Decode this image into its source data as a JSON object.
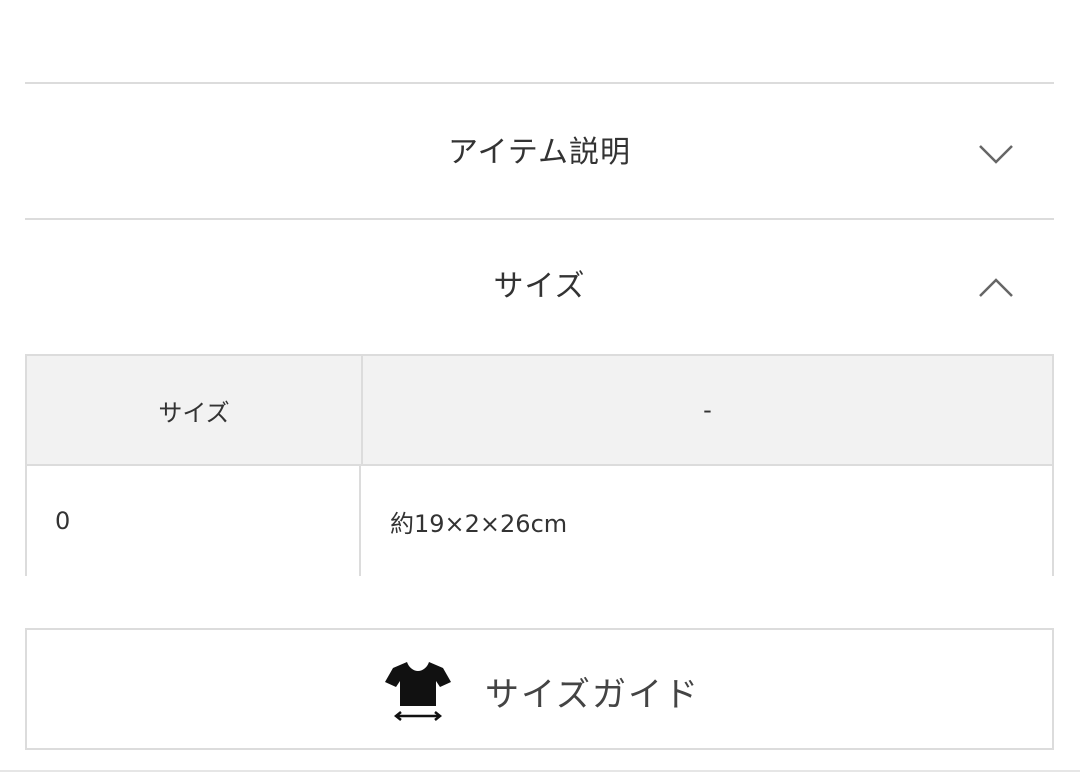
{
  "accordion": {
    "item_description": {
      "label": "アイテム説明",
      "expanded": false,
      "icon": "chevron-down-icon"
    },
    "size": {
      "label": "サイズ",
      "expanded": true,
      "icon": "chevron-up-icon"
    }
  },
  "size_table": {
    "header": {
      "col1": "サイズ",
      "col2": "-"
    },
    "rows": [
      {
        "size": "0",
        "dimensions": "約19×2×26cm"
      }
    ]
  },
  "size_guide": {
    "label": "サイズガイド",
    "icon": "tshirt-measure-icon"
  },
  "colors": {
    "border": "#dcdcdc",
    "header_bg": "#f2f2f2",
    "text": "#333333"
  }
}
